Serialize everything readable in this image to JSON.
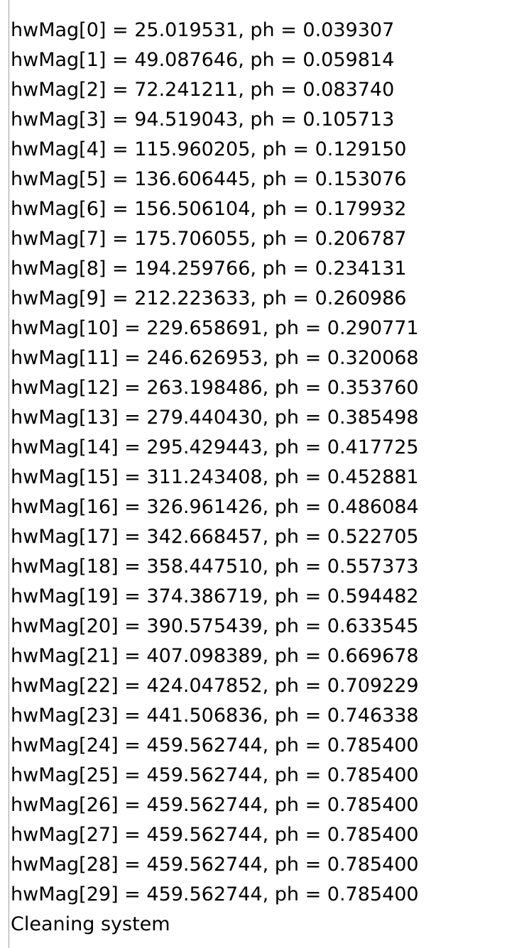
{
  "console": {
    "lines": [
      "hwMag[0] = 25.019531, ph = 0.039307",
      "hwMag[1] = 49.087646, ph = 0.059814",
      "hwMag[2] = 72.241211, ph = 0.083740",
      "hwMag[3] = 94.519043, ph = 0.105713",
      "hwMag[4] = 115.960205, ph = 0.129150",
      "hwMag[5] = 136.606445, ph = 0.153076",
      "hwMag[6] = 156.506104, ph = 0.179932",
      "hwMag[7] = 175.706055, ph = 0.206787",
      "hwMag[8] = 194.259766, ph = 0.234131",
      "hwMag[9] = 212.223633, ph = 0.260986",
      "hwMag[10] = 229.658691, ph = 0.290771",
      "hwMag[11] = 246.626953, ph = 0.320068",
      "hwMag[12] = 263.198486, ph = 0.353760",
      "hwMag[13] = 279.440430, ph = 0.385498",
      "hwMag[14] = 295.429443, ph = 0.417725",
      "hwMag[15] = 311.243408, ph = 0.452881",
      "hwMag[16] = 326.961426, ph = 0.486084",
      "hwMag[17] = 342.668457, ph = 0.522705",
      "hwMag[18] = 358.447510, ph = 0.557373",
      "hwMag[19] = 374.386719, ph = 0.594482",
      "hwMag[20] = 390.575439, ph = 0.633545",
      "hwMag[21] = 407.098389, ph = 0.669678",
      "hwMag[22] = 424.047852, ph = 0.709229",
      "hwMag[23] = 441.506836, ph = 0.746338",
      "hwMag[24] = 459.562744, ph = 0.785400",
      "hwMag[25] = 459.562744, ph = 0.785400",
      "hwMag[26] = 459.562744, ph = 0.785400",
      "hwMag[27] = 459.562744, ph = 0.785400",
      "hwMag[28] = 459.562744, ph = 0.785400",
      "hwMag[29] = 459.562744, ph = 0.785400",
      "Cleaning system"
    ]
  }
}
